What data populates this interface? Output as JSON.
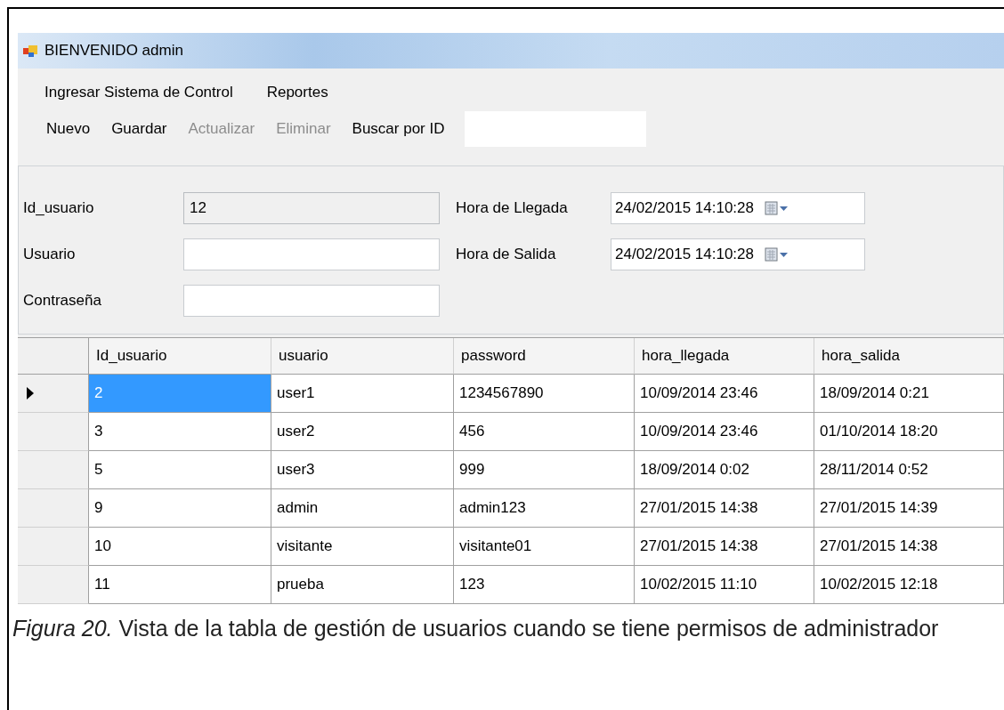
{
  "window": {
    "title": "BIENVENIDO admin"
  },
  "menu": [
    {
      "label": "Ingresar Sistema de Control"
    },
    {
      "label": "Reportes"
    }
  ],
  "toolbar": [
    {
      "label": "Nuevo",
      "disabled": false
    },
    {
      "label": "Guardar",
      "disabled": false
    },
    {
      "label": "Actualizar",
      "disabled": true
    },
    {
      "label": "Eliminar",
      "disabled": true
    }
  ],
  "search": {
    "label": "Buscar por ID"
  },
  "form_left": [
    {
      "label": "Id_usuario",
      "value": "12",
      "disabled": true
    },
    {
      "label": "Usuario",
      "disabled": false
    },
    {
      "label": "Contraseña",
      "disabled": false
    }
  ],
  "form_right": [
    {
      "label": "Hora de Llegada",
      "value": "24/02/2015 14:10:28"
    },
    {
      "label": "Hora de Salida",
      "value": "24/02/2015 14:10:28"
    }
  ],
  "table": {
    "columns": [
      "Id_usuario",
      "usuario",
      "password",
      "hora_llegada",
      "hora_salida"
    ],
    "rows": [
      {
        "selected": true,
        "cells": [
          "2",
          "user1",
          "1234567890",
          "10/09/2014 23:46",
          "18/09/2014 0:21"
        ]
      },
      {
        "selected": false,
        "cells": [
          "3",
          "user2",
          "456",
          "10/09/2014 23:46",
          "01/10/2014 18:20"
        ]
      },
      {
        "selected": false,
        "cells": [
          "5",
          "user3",
          "999",
          "18/09/2014 0:02",
          "28/11/2014 0:52"
        ]
      },
      {
        "selected": false,
        "cells": [
          "9",
          "admin",
          "admin123",
          "27/01/2015 14:38",
          "27/01/2015 14:39"
        ]
      },
      {
        "selected": false,
        "cells": [
          "10",
          "visitante",
          "visitante01",
          "27/01/2015 14:38",
          "27/01/2015 14:38"
        ]
      },
      {
        "selected": false,
        "cells": [
          "11",
          "prueba",
          "123",
          "10/02/2015 11:10",
          "10/02/2015 12:18"
        ]
      }
    ]
  },
  "caption": "*Figura 20.* Vista de la tabla de gestión de usuarios cuando se tiene permisos de administrador"
}
